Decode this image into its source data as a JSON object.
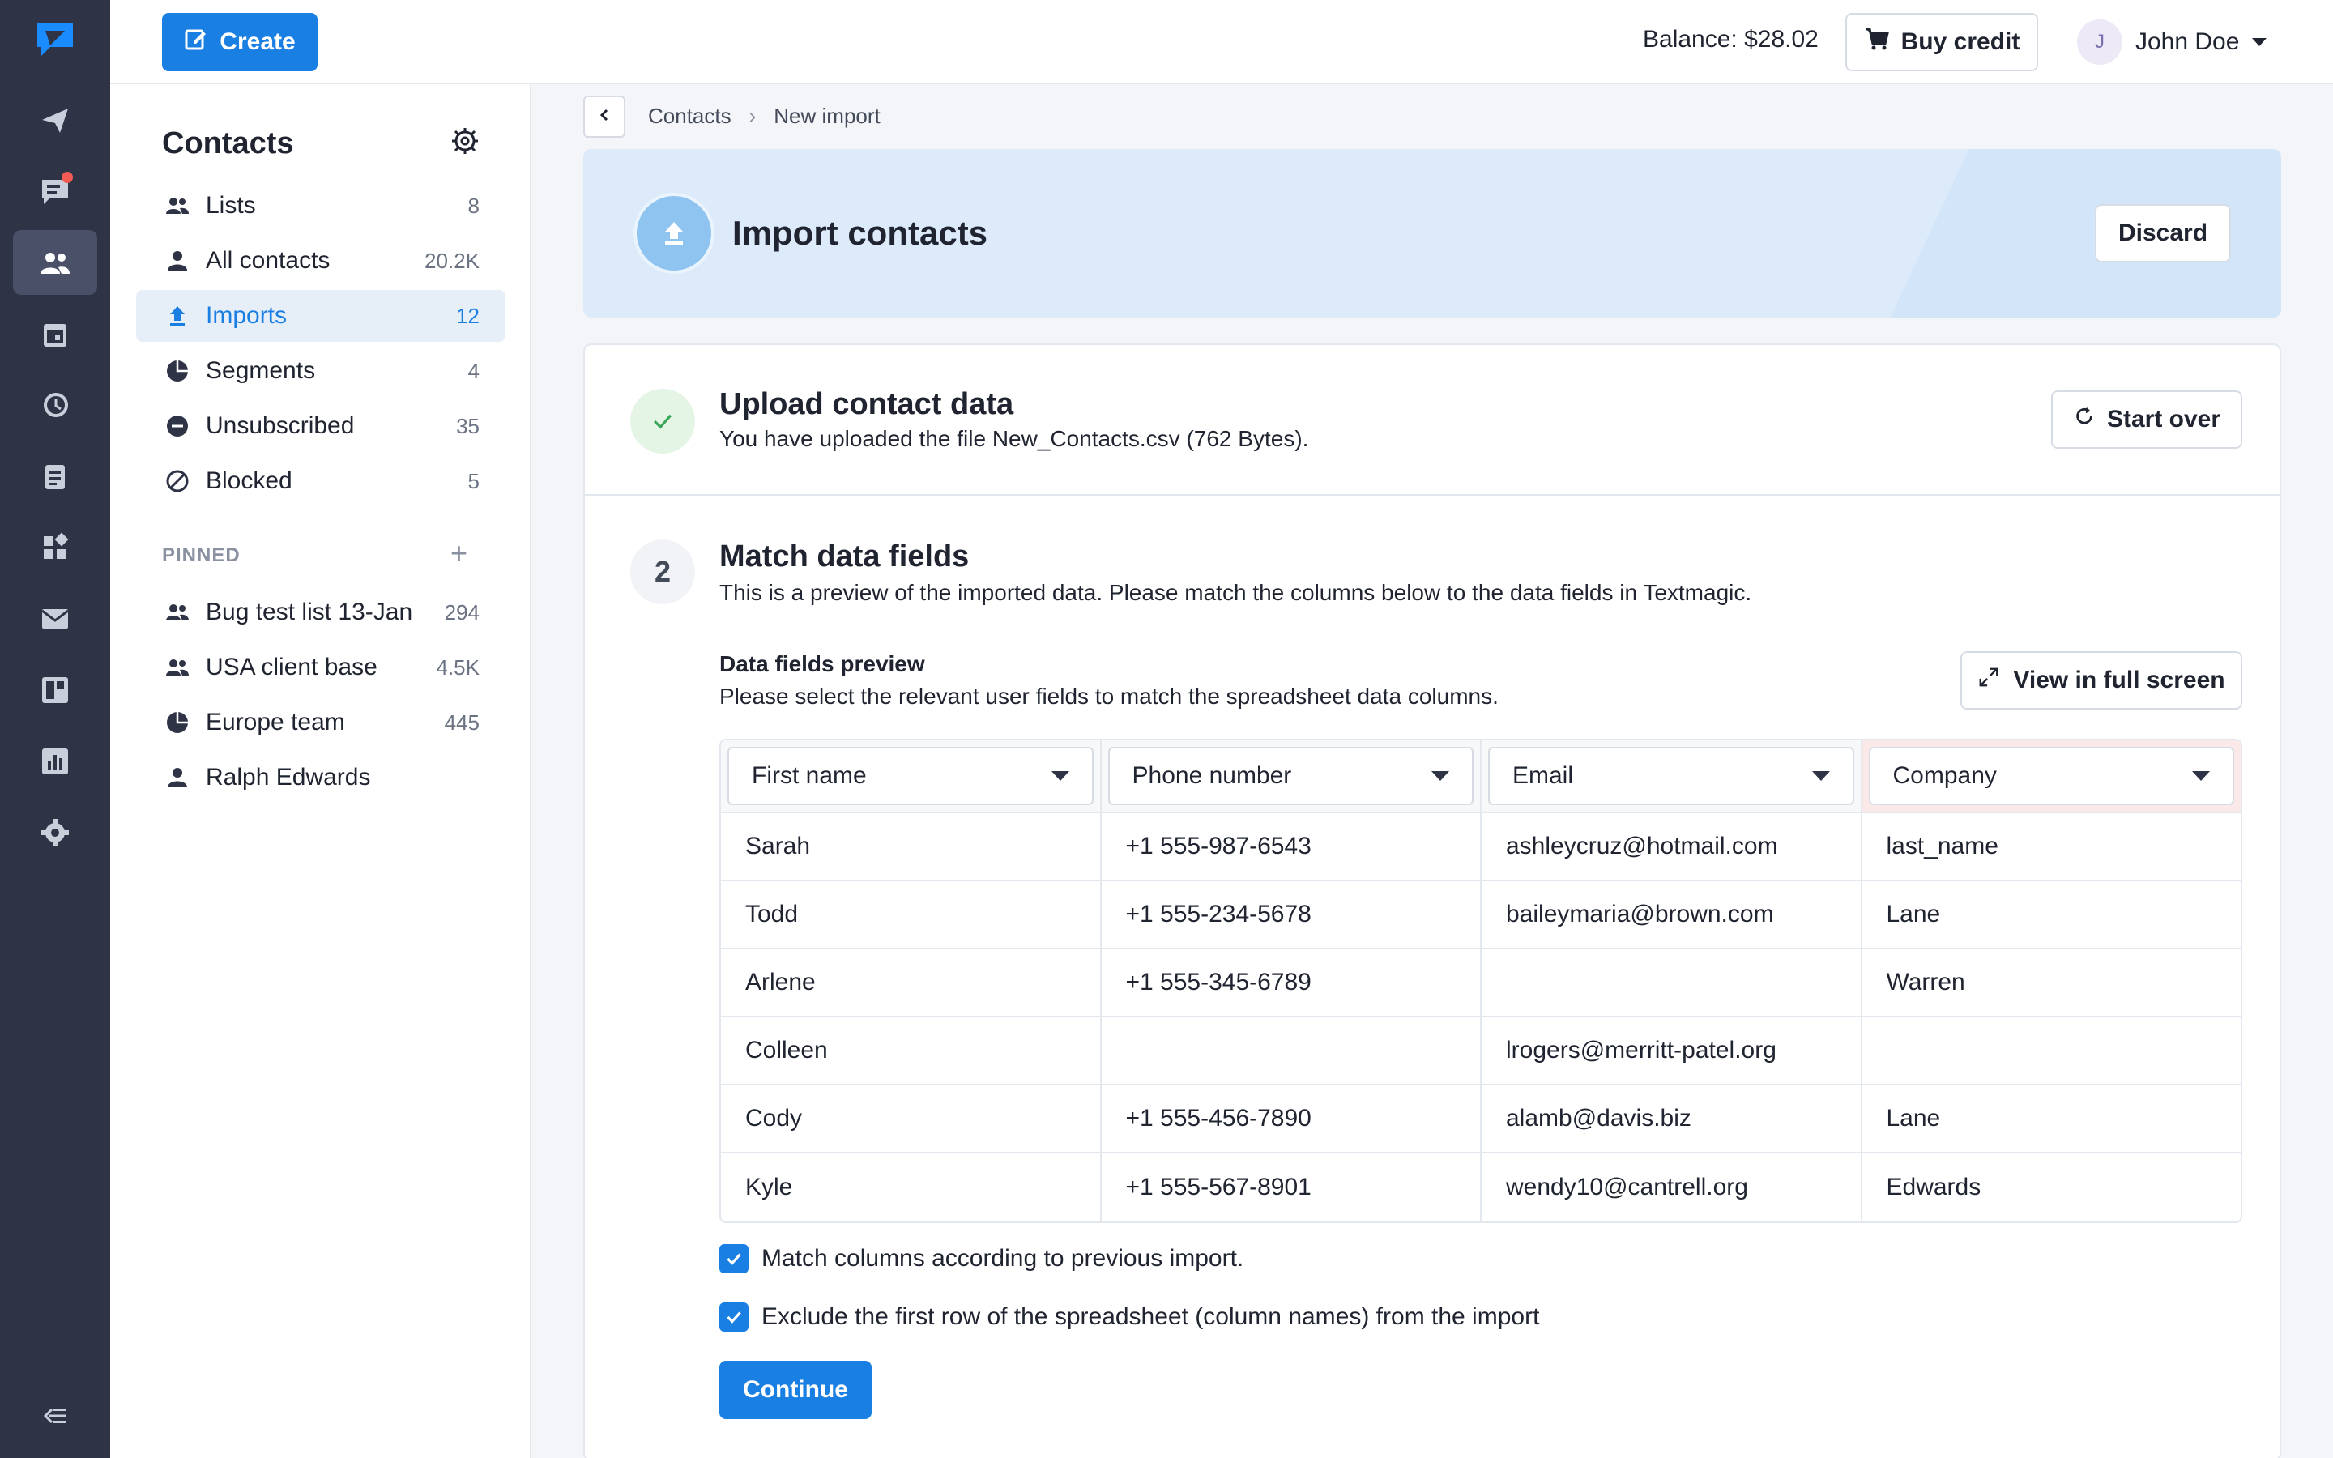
{
  "colors": {
    "accent": "#1a7fe2",
    "rail_bg": "#2f3346",
    "notification_dot": "#f25c54",
    "success_bg": "#e4f5e6",
    "hero_bg": "#dceaf9"
  },
  "rail": {
    "icons": [
      "logo-icon",
      "send-icon",
      "chat-icon",
      "contacts-icon",
      "calendar-icon",
      "history-icon",
      "clipboard-icon",
      "widgets-icon",
      "mail-icon",
      "board-icon",
      "chart-icon",
      "settings-icon",
      "collapse-icon"
    ],
    "active": "contacts-icon"
  },
  "topbar": {
    "create_label": "Create",
    "balance": "Balance: $28.02",
    "buy_credit_label": "Buy credit",
    "user_initial": "J",
    "user_name": "John Doe"
  },
  "panel": {
    "title": "Contacts",
    "items": [
      {
        "label": "Lists",
        "count": "8",
        "icon": "people-icon"
      },
      {
        "label": "All contacts",
        "count": "20.2K",
        "icon": "person-icon"
      },
      {
        "label": "Imports",
        "count": "12",
        "icon": "upload-icon",
        "active": true
      },
      {
        "label": "Segments",
        "count": "4",
        "icon": "pie-icon"
      },
      {
        "label": "Unsubscribed",
        "count": "35",
        "icon": "minus-circle-icon"
      },
      {
        "label": "Blocked",
        "count": "5",
        "icon": "blocked-icon"
      }
    ],
    "pinned_heading": "PINNED",
    "pinned": [
      {
        "label": "Bug test list 13-Jan",
        "count": "294",
        "icon": "people-icon"
      },
      {
        "label": "USA client base",
        "count": "4.5K",
        "icon": "people-icon"
      },
      {
        "label": "Europe team",
        "count": "445",
        "icon": "pie-icon"
      },
      {
        "label": "Ralph Edwards",
        "count": "",
        "icon": "person-icon"
      }
    ]
  },
  "breadcrumb": [
    "Contacts",
    "New import"
  ],
  "hero": {
    "title": "Import contacts",
    "discard_label": "Discard"
  },
  "step1": {
    "title": "Upload contact data",
    "sub_prefix": "You have uploaded the file ",
    "file_name": "New_Contacts.csv",
    "sub_suffix": " (762 Bytes).",
    "start_over_label": "Start over"
  },
  "step2": {
    "number": "2",
    "title": "Match data fields",
    "subtitle": "This is a preview of the imported data. Please match the columns below to the data fields in Textmagic.",
    "preview_title": "Data fields preview",
    "preview_sub": "Please select the relevant user fields to match the spreadsheet data columns.",
    "fullscreen_label": "View in full screen",
    "columns": [
      "First name",
      "Phone number",
      "Email",
      "Company"
    ],
    "rows": [
      [
        "Sarah",
        "+1 555-987-6543",
        "ashleycruz@hotmail.com",
        "last_name"
      ],
      [
        "Todd",
        "+1 555-234-5678",
        "baileymaria@brown.com",
        "Lane"
      ],
      [
        "Arlene",
        "+1 555-345-6789",
        "",
        "Warren"
      ],
      [
        "Colleen",
        "",
        "lrogers@merritt-patel.org",
        ""
      ],
      [
        "Cody",
        "+1 555-456-7890",
        "alamb@davis.biz",
        "Lane"
      ],
      [
        "Kyle",
        "+1 555-567-8901",
        "wendy10@cantrell.org",
        "Edwards"
      ]
    ],
    "check_match": "Match columns according to previous import.",
    "check_exclude": "Exclude the first row of the spreadsheet (column names) from the import",
    "continue_label": "Continue"
  }
}
